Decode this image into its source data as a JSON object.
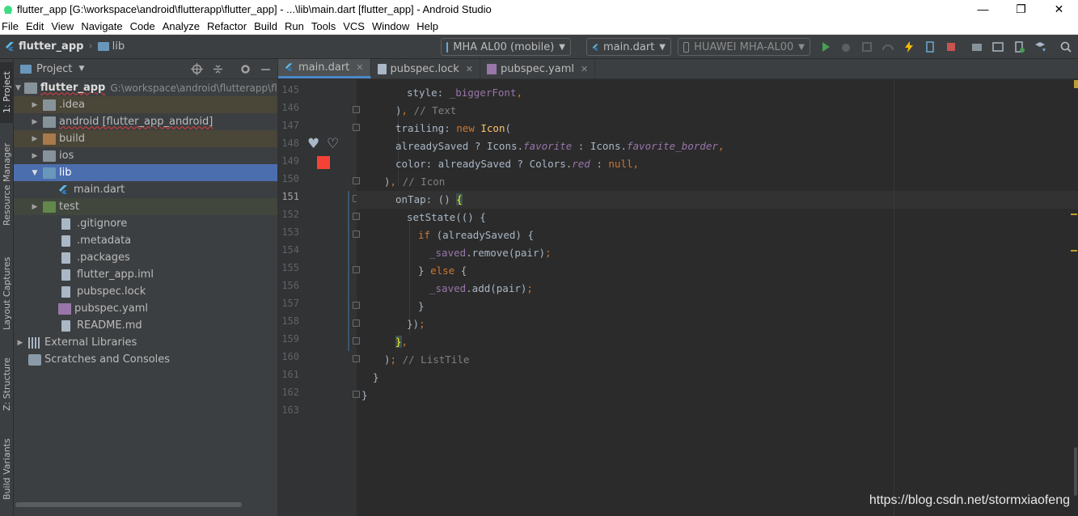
{
  "window": {
    "title": "flutter_app [G:\\workspace\\android\\flutterapp\\flutter_app] - ...\\lib\\main.dart [flutter_app] - Android Studio",
    "controls": [
      "—",
      "❐",
      "✕"
    ]
  },
  "menu": [
    "File",
    "Edit",
    "View",
    "Navigate",
    "Code",
    "Analyze",
    "Refactor",
    "Build",
    "Run",
    "Tools",
    "VCS",
    "Window",
    "Help"
  ],
  "breadcrumb": {
    "project": "flutter_app",
    "folder": "lib"
  },
  "toolbar": {
    "device_selector": "MHA AL00 (mobile)",
    "run_config": "main.dart",
    "device_target": "HUAWEI MHA-AL00"
  },
  "side_tabs": [
    "1: Project",
    "Resource Manager",
    "Layout Captures",
    "Z: Structure",
    "Build Variants"
  ],
  "project_panel": {
    "header": "Project",
    "tree": [
      {
        "indent": 0,
        "arrow": "▼",
        "label": "flutter_app",
        "path": "G:\\workspace\\android\\flutterapp\\flut",
        "icon": "folder",
        "bold": true
      },
      {
        "indent": 1,
        "arrow": "▶",
        "label": ".idea",
        "icon": "folder"
      },
      {
        "indent": 1,
        "arrow": "▶",
        "label": "android [flutter_app_android]",
        "icon": "folder"
      },
      {
        "indent": 1,
        "arrow": "▶",
        "label": "build",
        "icon": "folder-orange"
      },
      {
        "indent": 1,
        "arrow": "▶",
        "label": "ios",
        "icon": "folder"
      },
      {
        "indent": 1,
        "arrow": "▼",
        "label": "lib",
        "icon": "folder-blue",
        "selected": true
      },
      {
        "indent": 2,
        "arrow": "",
        "label": "main.dart",
        "icon": "dart"
      },
      {
        "indent": 1,
        "arrow": "▶",
        "label": "test",
        "icon": "folder"
      },
      {
        "indent": 1,
        "arrow": "",
        "label": ".gitignore",
        "icon": "file"
      },
      {
        "indent": 1,
        "arrow": "",
        "label": ".metadata",
        "icon": "file"
      },
      {
        "indent": 1,
        "arrow": "",
        "label": ".packages",
        "icon": "file"
      },
      {
        "indent": 1,
        "arrow": "",
        "label": "flutter_app.iml",
        "icon": "file"
      },
      {
        "indent": 1,
        "arrow": "",
        "label": "pubspec.lock",
        "icon": "file"
      },
      {
        "indent": 1,
        "arrow": "",
        "label": "pubspec.yaml",
        "icon": "yaml"
      },
      {
        "indent": 1,
        "arrow": "",
        "label": "README.md",
        "icon": "file"
      },
      {
        "indent": 0,
        "arrow": "▶",
        "label": "External Libraries",
        "icon": "lib"
      },
      {
        "indent": 0,
        "arrow": "",
        "label": "Scratches and Consoles",
        "icon": "scratch"
      }
    ]
  },
  "editor_tabs": [
    {
      "label": "main.dart",
      "active": true,
      "icon": "dart"
    },
    {
      "label": "pubspec.lock",
      "active": false,
      "icon": "file"
    },
    {
      "label": "pubspec.yaml",
      "active": false,
      "icon": "yaml"
    }
  ],
  "code": {
    "current_line": 151,
    "lines": [
      {
        "n": 145,
        "text": "        style: _biggerFont,"
      },
      {
        "n": 146,
        "text": "      ), // Text"
      },
      {
        "n": 147,
        "text": "      trailing: new Icon("
      },
      {
        "n": 148,
        "text": "      alreadySaved ? Icons.favorite : Icons.favorite_border,"
      },
      {
        "n": 149,
        "text": "      color: alreadySaved ? Colors.red : null,"
      },
      {
        "n": 150,
        "text": "    ), // Icon"
      },
      {
        "n": 151,
        "text": "      onTap: () {"
      },
      {
        "n": 152,
        "text": "        setState(() {"
      },
      {
        "n": 153,
        "text": "          if (alreadySaved) {"
      },
      {
        "n": 154,
        "text": "            _saved.remove(pair);"
      },
      {
        "n": 155,
        "text": "          } else {"
      },
      {
        "n": 156,
        "text": "            _saved.add(pair);"
      },
      {
        "n": 157,
        "text": "          }"
      },
      {
        "n": 158,
        "text": "        });"
      },
      {
        "n": 159,
        "text": "      },"
      },
      {
        "n": 160,
        "text": "    ); // ListTile"
      },
      {
        "n": 161,
        "text": "  }"
      },
      {
        "n": 162,
        "text": "}"
      },
      {
        "n": 163,
        "text": ""
      }
    ]
  },
  "gutter_marks": {
    "favorite_icons": [
      "♥",
      "♡"
    ],
    "color_swatch": "#f44336"
  },
  "watermark": "https://blog.csdn.net/stormxiaofeng",
  "colors": {
    "accent": "#4a88c7",
    "selection": "#4b6eaf",
    "keyword": "#cc7832"
  }
}
